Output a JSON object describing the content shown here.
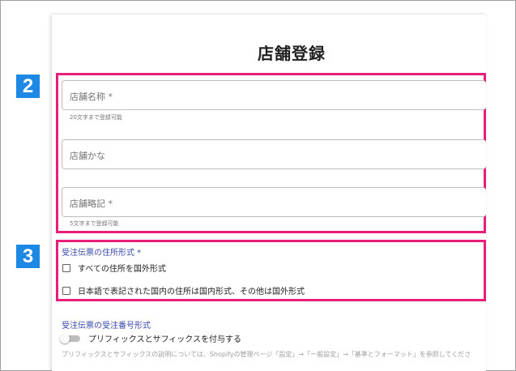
{
  "page": {
    "title": "店舗登録"
  },
  "steps": [
    {
      "number": "2"
    },
    {
      "number": "3"
    }
  ],
  "fields": {
    "store_name": {
      "placeholder": "店舗名称 *",
      "hint": "20文字まで登録可能"
    },
    "store_kana": {
      "placeholder": "店舗かな"
    },
    "store_abbr": {
      "placeholder": "店舗略記 *",
      "hint": "5文字まで登録可能"
    }
  },
  "address_format": {
    "label": "受注伝票の住所形式 *",
    "options": [
      {
        "label": "すべての住所を国外形式",
        "checked": false
      },
      {
        "label": "日本語で表記された国内の住所は国内形式、その他は国外形式",
        "checked": false
      }
    ]
  },
  "order_number_format": {
    "label": "受注伝票の受注番号形式",
    "toggle": {
      "label": "プリフィックスとサフィックスを付与する",
      "on": false
    }
  },
  "footnote": "プリフィックスとサフィックスの説明については、Shopifyの管理ページ「設定」→「一般設定」→「基準とフォーマット」を参照してくださ",
  "colors": {
    "highlight": "#e91e78",
    "badge": "#1e88e5",
    "section_label": "#3949ab"
  }
}
